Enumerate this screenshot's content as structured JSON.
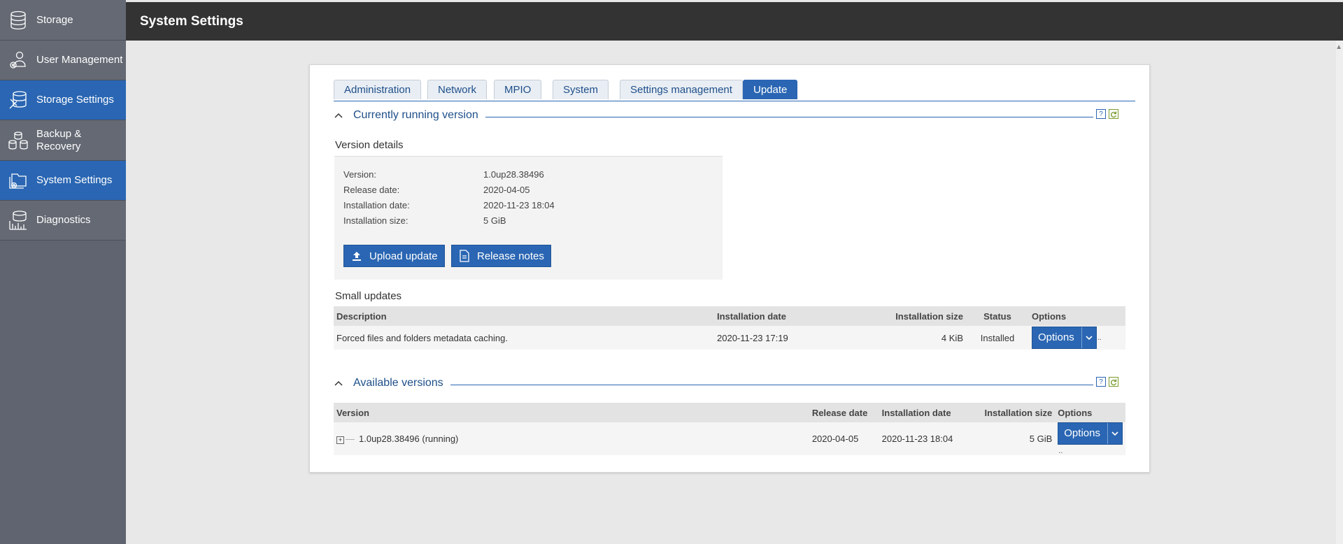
{
  "sidebar": {
    "items": [
      {
        "label": "Storage",
        "icon": "database-icon",
        "active": false
      },
      {
        "label": "User Management",
        "icon": "user-gear-icon",
        "active": false
      },
      {
        "label": "Storage Settings",
        "icon": "database-tools-icon",
        "active": true
      },
      {
        "label": "Backup & Recovery",
        "icon": "backup-icon",
        "active": false
      },
      {
        "label": "System Settings",
        "icon": "settings-folder-icon",
        "active": true
      },
      {
        "label": "Diagnostics",
        "icon": "diagnostics-icon",
        "active": false
      }
    ]
  },
  "header": {
    "title": "System Settings"
  },
  "tabs": [
    "Administration",
    "Network",
    "MPIO",
    "System",
    "Settings management",
    "Update"
  ],
  "active_tab": "Update",
  "current": {
    "section_title": "Currently running version",
    "details_title": "Version details",
    "rows": [
      {
        "label": "Version:",
        "value": "1.0up28.38496"
      },
      {
        "label": "Release date:",
        "value": "2020-04-05"
      },
      {
        "label": "Installation date:",
        "value": "2020-11-23 18:04"
      },
      {
        "label": "Installation size:",
        "value": "5 GiB"
      }
    ],
    "upload_label": "Upload update",
    "notes_label": "Release notes",
    "help_glyph": "?"
  },
  "small_updates": {
    "title": "Small updates",
    "columns": [
      "Description",
      "Installation date",
      "Installation size",
      "Status",
      "Options"
    ],
    "rows": [
      {
        "description": "Forced files and folders metadata caching.",
        "installation_date": "2020-11-23 17:19",
        "installation_size": "4 KiB",
        "status": "Installed",
        "options_label": "Options"
      }
    ]
  },
  "available": {
    "section_title": "Available versions",
    "columns": [
      "Version",
      "Release date",
      "Installation date",
      "Installation size",
      "Options"
    ],
    "rows": [
      {
        "version": "1.0up28.38496 (running)",
        "release_date": "2020-04-05",
        "installation_date": "2020-11-23 18:04",
        "installation_size": "5 GiB",
        "options_label": "Options"
      }
    ]
  },
  "colors": {
    "accent": "#2a66b3",
    "topbar": "#333333",
    "sidebar": "#646973"
  }
}
